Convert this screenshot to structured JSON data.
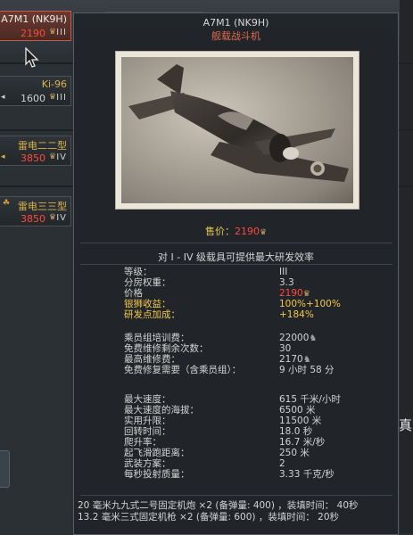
{
  "tree": {
    "tiles": [
      {
        "name": "A7M1 (NK9H)",
        "price": "2190",
        "rank": "III",
        "selected": true
      },
      {
        "name": "Ki-96",
        "price": "1600",
        "rank": "III",
        "selected": false
      },
      {
        "name": "雷电二二型",
        "price": "3850",
        "rank": "IV",
        "selected": false
      },
      {
        "name": "雷电三三型",
        "price": "3850",
        "rank": "IV",
        "selected": false
      }
    ],
    "partial_text": "真"
  },
  "tooltip": {
    "title": "A7M1 (NK9H)",
    "subtitle": "舰载战斗机",
    "sale_label": "售价：",
    "sale_value": "2190",
    "research_note": "对 I - IV 级载具可提供最大研发效率",
    "stats": {
      "rank": {
        "label": "等级：",
        "value": "III"
      },
      "br": {
        "label": "分房权重：",
        "value": "3.3"
      },
      "price": {
        "label": "价格",
        "value": "2190"
      },
      "sl_gain": {
        "label": "银狮收益：",
        "value": "100%+100%"
      },
      "rp_bonus": {
        "label": "研发点加成：",
        "value": "+184%"
      },
      "crew_cost": {
        "label": "乘员组培训费：",
        "value": "22000"
      },
      "free_repairs": {
        "label": "免费维修剩余次数：",
        "value": "30"
      },
      "max_repair": {
        "label": "最高维修费：",
        "value": "2170"
      },
      "repair_time": {
        "label": "免费修复需要（含乘员组）：",
        "value": "9 小时 58 分"
      },
      "max_speed": {
        "label": "最大速度：",
        "value": "615 千米/小时"
      },
      "max_speed_alt": {
        "label": "最大速度的海拔：",
        "value": "6500 米"
      },
      "ceiling": {
        "label": "实用升限：",
        "value": "11500 米"
      },
      "turn_time": {
        "label": "回转时间：",
        "value": "18.0 秒"
      },
      "climb": {
        "label": "爬升率：",
        "value": "16.7 米/秒"
      },
      "takeoff": {
        "label": "起飞滑跑距离：",
        "value": "250 米"
      },
      "presets": {
        "label": "武装方案：",
        "value": "2"
      },
      "burst": {
        "label": "每秒投射质量：",
        "value": "3.33 千克/秒"
      }
    },
    "weapons": [
      "20 毫米九九式二号固定机炮 ×2 (备弹量: 400) ，装填时间： 40秒",
      "13.2 毫米三式固定机枪 ×2 (备弹量: 600) ，装填时间： 20秒"
    ]
  },
  "colors": {
    "accent_red": "#ff4a3a",
    "gold": "#f2c84a",
    "subtitle": "#e2694e"
  }
}
